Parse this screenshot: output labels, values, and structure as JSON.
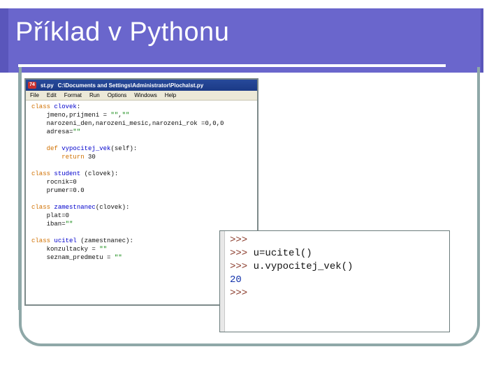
{
  "slide": {
    "title": "Příklad v Pythonu"
  },
  "editor": {
    "app_icon": "74",
    "title": "st.py",
    "path": "C:\\Documents and Settings\\Administrator\\Plocha\\st.py",
    "menu": [
      "File",
      "Edit",
      "Format",
      "Run",
      "Options",
      "Windows",
      "Help"
    ],
    "code": [
      "class clovek:",
      "    jmeno,prijmeni = \"\",\"\"",
      "    narozeni_den,narozeni_mesic,narozeni_rok =0,0,0",
      "    adresa=\"\"",
      "",
      "    def vypocitej_vek(self):",
      "        return 30",
      "",
      "class student (clovek):",
      "    rocnik=0",
      "    prumer=0.0",
      "",
      "class zamestnanec(clovek):",
      "    plat=0",
      "    iban=\"\"",
      "",
      "class ucitel (zamestnanec):",
      "    konzultacky = \"\"",
      "    seznam_predmetu = \"\""
    ]
  },
  "shell": {
    "lines": [
      {
        "prompt": ">>>",
        "text": ""
      },
      {
        "prompt": ">>>",
        "text": " u=ucitel()"
      },
      {
        "prompt": ">>>",
        "text": " u.vypocitej_vek()"
      },
      {
        "prompt": "",
        "text": "20"
      },
      {
        "prompt": ">>>",
        "text": ""
      }
    ]
  }
}
